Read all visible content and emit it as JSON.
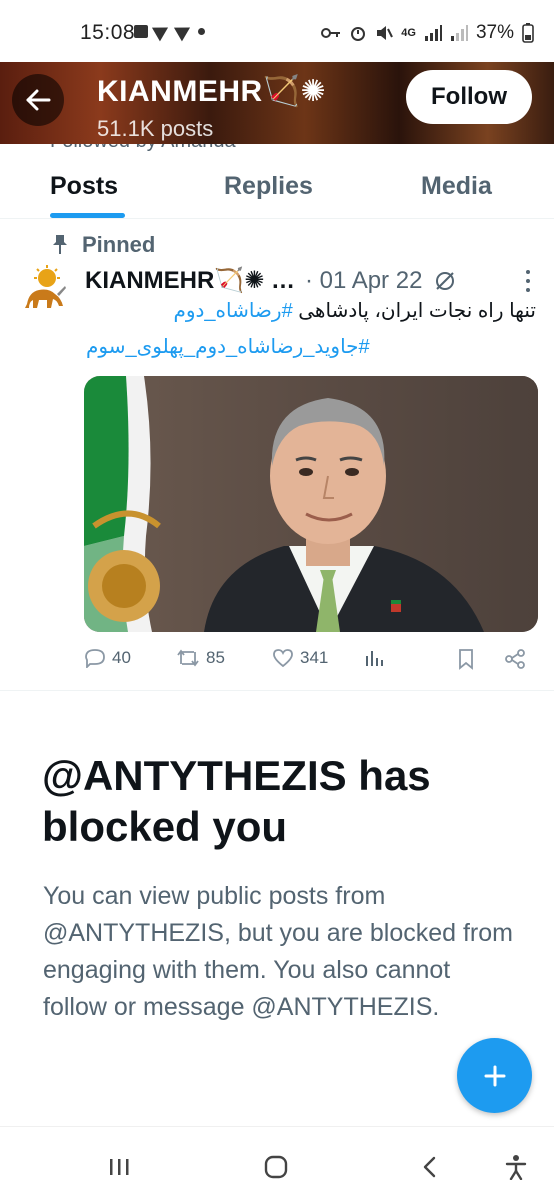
{
  "status_bar": {
    "time": "15:08",
    "network": "4G",
    "battery": "37%"
  },
  "header": {
    "display_name": "KIANMEHR🏹✺",
    "posts_count": "51.1K posts",
    "follow_label": "Follow",
    "peek_text": "Followed by Amanda"
  },
  "tabs": [
    {
      "label": "Posts",
      "active": true
    },
    {
      "label": "Replies",
      "active": false
    },
    {
      "label": "Media",
      "active": false
    }
  ],
  "post": {
    "pinned_label": "Pinned",
    "author": "KIANMEHR🏹✺ …",
    "meta": "· 01 Apr 22",
    "text_plain": "تنها راه نجات ایران، پادشاهی",
    "hashtag1": "#رضاشاه_دوم",
    "hashtag2": "#جاوید_رضاشاه_دوم_پهلوی_سوم",
    "replies": "40",
    "reposts": "85",
    "likes": "341"
  },
  "blocked": {
    "title": "@ANTYTHEZIS has blocked you",
    "body": "You can view public posts from @ANTYTHEZIS, but you are blocked from engaging with them. You also cannot follow or message @ANTYTHEZIS."
  },
  "fab": {
    "label": "+"
  },
  "colors": {
    "accent": "#1d9bf0",
    "text_primary": "#0f1419",
    "text_secondary": "#536471"
  }
}
